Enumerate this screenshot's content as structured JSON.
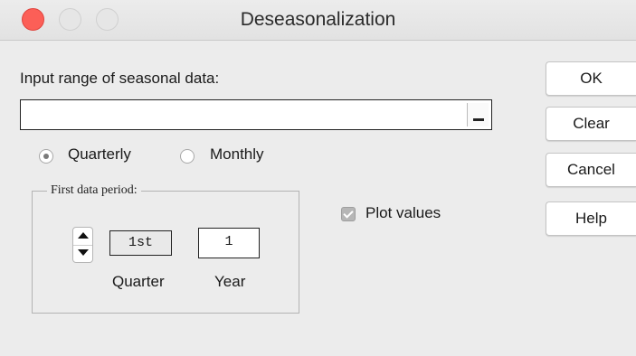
{
  "window": {
    "title": "Deseasonalization"
  },
  "form": {
    "range_label": "Input range of seasonal data:",
    "range_value": "",
    "frequency": {
      "options": [
        {
          "label": "Quarterly",
          "checked": true
        },
        {
          "label": "Monthly",
          "checked": false
        }
      ]
    },
    "first_period": {
      "group_title": "First data period:",
      "quarter_value": "1st",
      "year_value": "1",
      "quarter_label": "Quarter",
      "year_label": "Year"
    },
    "plot_values": {
      "label": "Plot values",
      "checked": true
    }
  },
  "buttons": {
    "ok": "OK",
    "clear": "Clear",
    "cancel": "Cancel",
    "help": "Help"
  },
  "colors": {
    "close": "#fc5f57",
    "window_bg": "#ececec"
  }
}
